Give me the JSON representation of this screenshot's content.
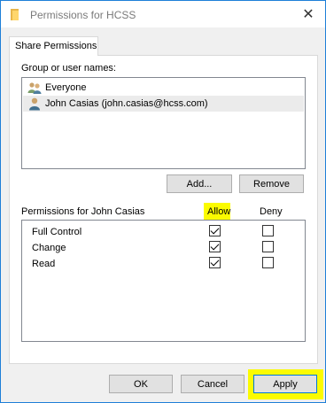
{
  "window": {
    "title": "Permissions for HCSS"
  },
  "tabs": [
    {
      "label": "Share Permissions"
    }
  ],
  "users": {
    "label": "Group or user names:",
    "items": [
      {
        "name": "Everyone",
        "icon": "group-users-icon",
        "selected": false
      },
      {
        "name": "John Casias (john.casias@hcss.com)",
        "icon": "user-icon",
        "selected": true
      }
    ],
    "add_label": "Add...",
    "remove_label": "Remove"
  },
  "permissions": {
    "title": "Permissions for John Casias",
    "allow_label": "Allow",
    "deny_label": "Deny",
    "rows": [
      {
        "name": "Full Control",
        "allow": true,
        "deny": false
      },
      {
        "name": "Change",
        "allow": true,
        "deny": false
      },
      {
        "name": "Read",
        "allow": true,
        "deny": false
      }
    ]
  },
  "footer": {
    "ok_label": "OK",
    "cancel_label": "Cancel",
    "apply_label": "Apply"
  },
  "colors": {
    "highlight": "#fbfb00",
    "accent": "#0078d7"
  }
}
